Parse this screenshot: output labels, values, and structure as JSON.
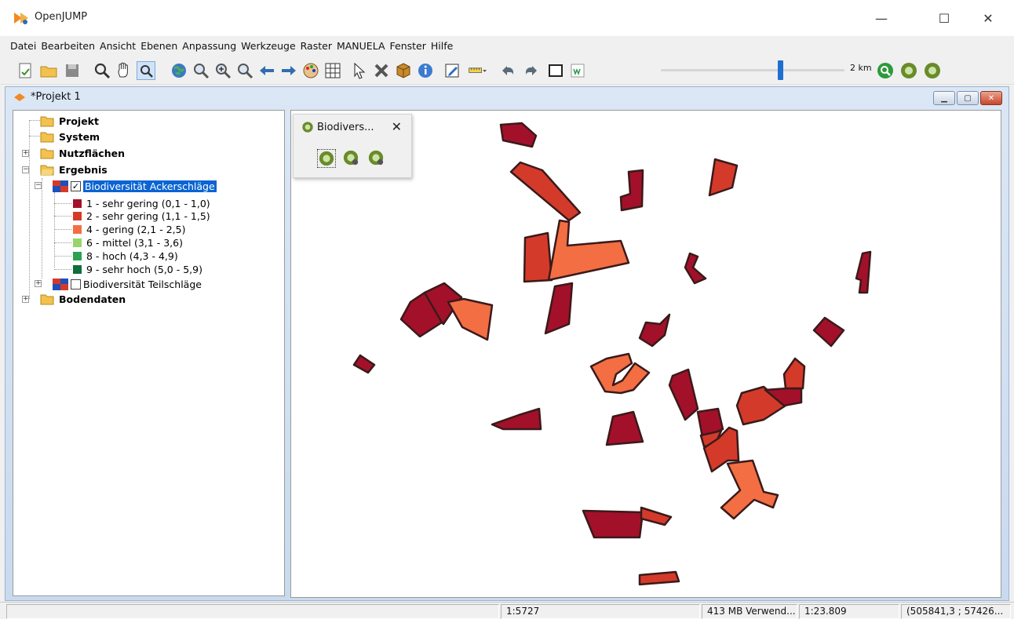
{
  "window": {
    "title": "OpenJUMP",
    "minimize": "—",
    "maximize": "☐",
    "close": "✕"
  },
  "menu": [
    "Datei",
    "Bearbeiten",
    "Ansicht",
    "Ebenen",
    "Anpassung",
    "Werkzeuge",
    "Raster",
    "MANUELA",
    "Fenster",
    "Hilfe"
  ],
  "toolbar": {
    "scale_label": "2 km",
    "zoom_slider_value": 0.65
  },
  "project": {
    "title": "*Projekt 1"
  },
  "tree": {
    "categories": [
      {
        "label": "Projekt"
      },
      {
        "label": "System"
      },
      {
        "label": "Nutzflächen"
      },
      {
        "label": "Ergebnis"
      },
      {
        "label": "Bodendaten"
      }
    ],
    "layer_checked": "Biodiversität Ackerschläge",
    "legend": [
      {
        "label": "1 - sehr gering (0,1 - 1,0)",
        "color": "#a3102a"
      },
      {
        "label": "2 - sehr gering (1,1 - 1,5)",
        "color": "#d43a2a"
      },
      {
        "label": "4 - gering (2,1 - 2,5)",
        "color": "#f36e43"
      },
      {
        "label": "6 - mittel (3,1 - 3,6)",
        "color": "#98d46a"
      },
      {
        "label": "8 - hoch (4,3 - 4,9)",
        "color": "#2aa24f"
      },
      {
        "label": "9 - sehr hoch (5,0 - 5,9)",
        "color": "#0f6e3b"
      }
    ],
    "layer_unchecked": "Biodiversität Teilschläge"
  },
  "popup": {
    "title": "Biodivers...",
    "close": "✕"
  },
  "map_colors": {
    "class1": "#a3102a",
    "class2": "#d43a2a",
    "class4": "#f36e43",
    "outline": "#3a1a1a"
  },
  "status": {
    "message": "",
    "scale": "1:5727",
    "memory": "413 MB Verwend...",
    "scale2": "1:23.809",
    "coords": "(505841,3 ; 57426..."
  }
}
